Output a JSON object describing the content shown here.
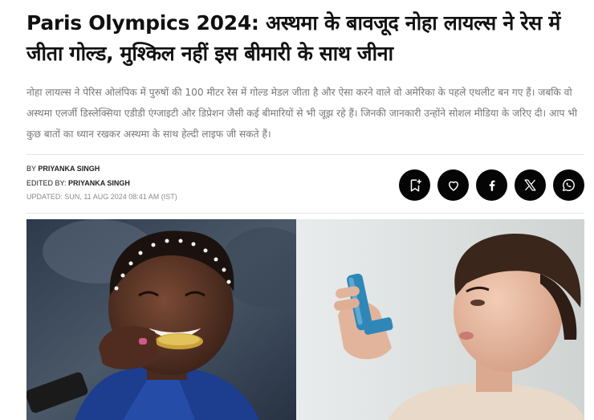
{
  "article": {
    "headline": "Paris Olympics 2024: अस्थमा के बावजूद नोहा लायल्स ने रेस में जीता गोल्ड, मुश्किल नहीं इस बीमारी के साथ जीना",
    "summary": "नोहा लायल्स ने पेरिस ओलंपिक में पुरुषों की 100 मीटर रेस में गोल्ड मेडल जीता है और ऐसा करने वाले वो अमेरिका के पहले एथलीट बन गए हैं। जबकि वो अस्थमा एलर्जी डिस्लेक्सिया एडीडी एंग्जाइटी और डिप्रेशन जैसी कई बीमारियों से भी जूझ रहे हैं। जिनकी जानकारी उन्होंने सोशल मीडिया के जरिए दी। आप भी कुछ बातों का ध्यान रखकर अस्थमा के साथ हेल्दी लाइफ जी सकते हैं।"
  },
  "byline": {
    "by_prefix": "BY",
    "author": "PRIYANKA SINGH",
    "edited_prefix": "EDITED BY:",
    "editor": "PRIYANKA SINGH",
    "updated": "UPDATED: SUN, 11 AUG 2024 08:41 AM (IST)"
  },
  "share": {
    "icons": [
      "bookmark-icon",
      "heart-icon",
      "facebook-icon",
      "x-icon",
      "whatsapp-icon"
    ],
    "color": "#050505"
  },
  "colors": {
    "headline": "#111111",
    "summary": "#777777",
    "divider": "#e7e7e7"
  }
}
